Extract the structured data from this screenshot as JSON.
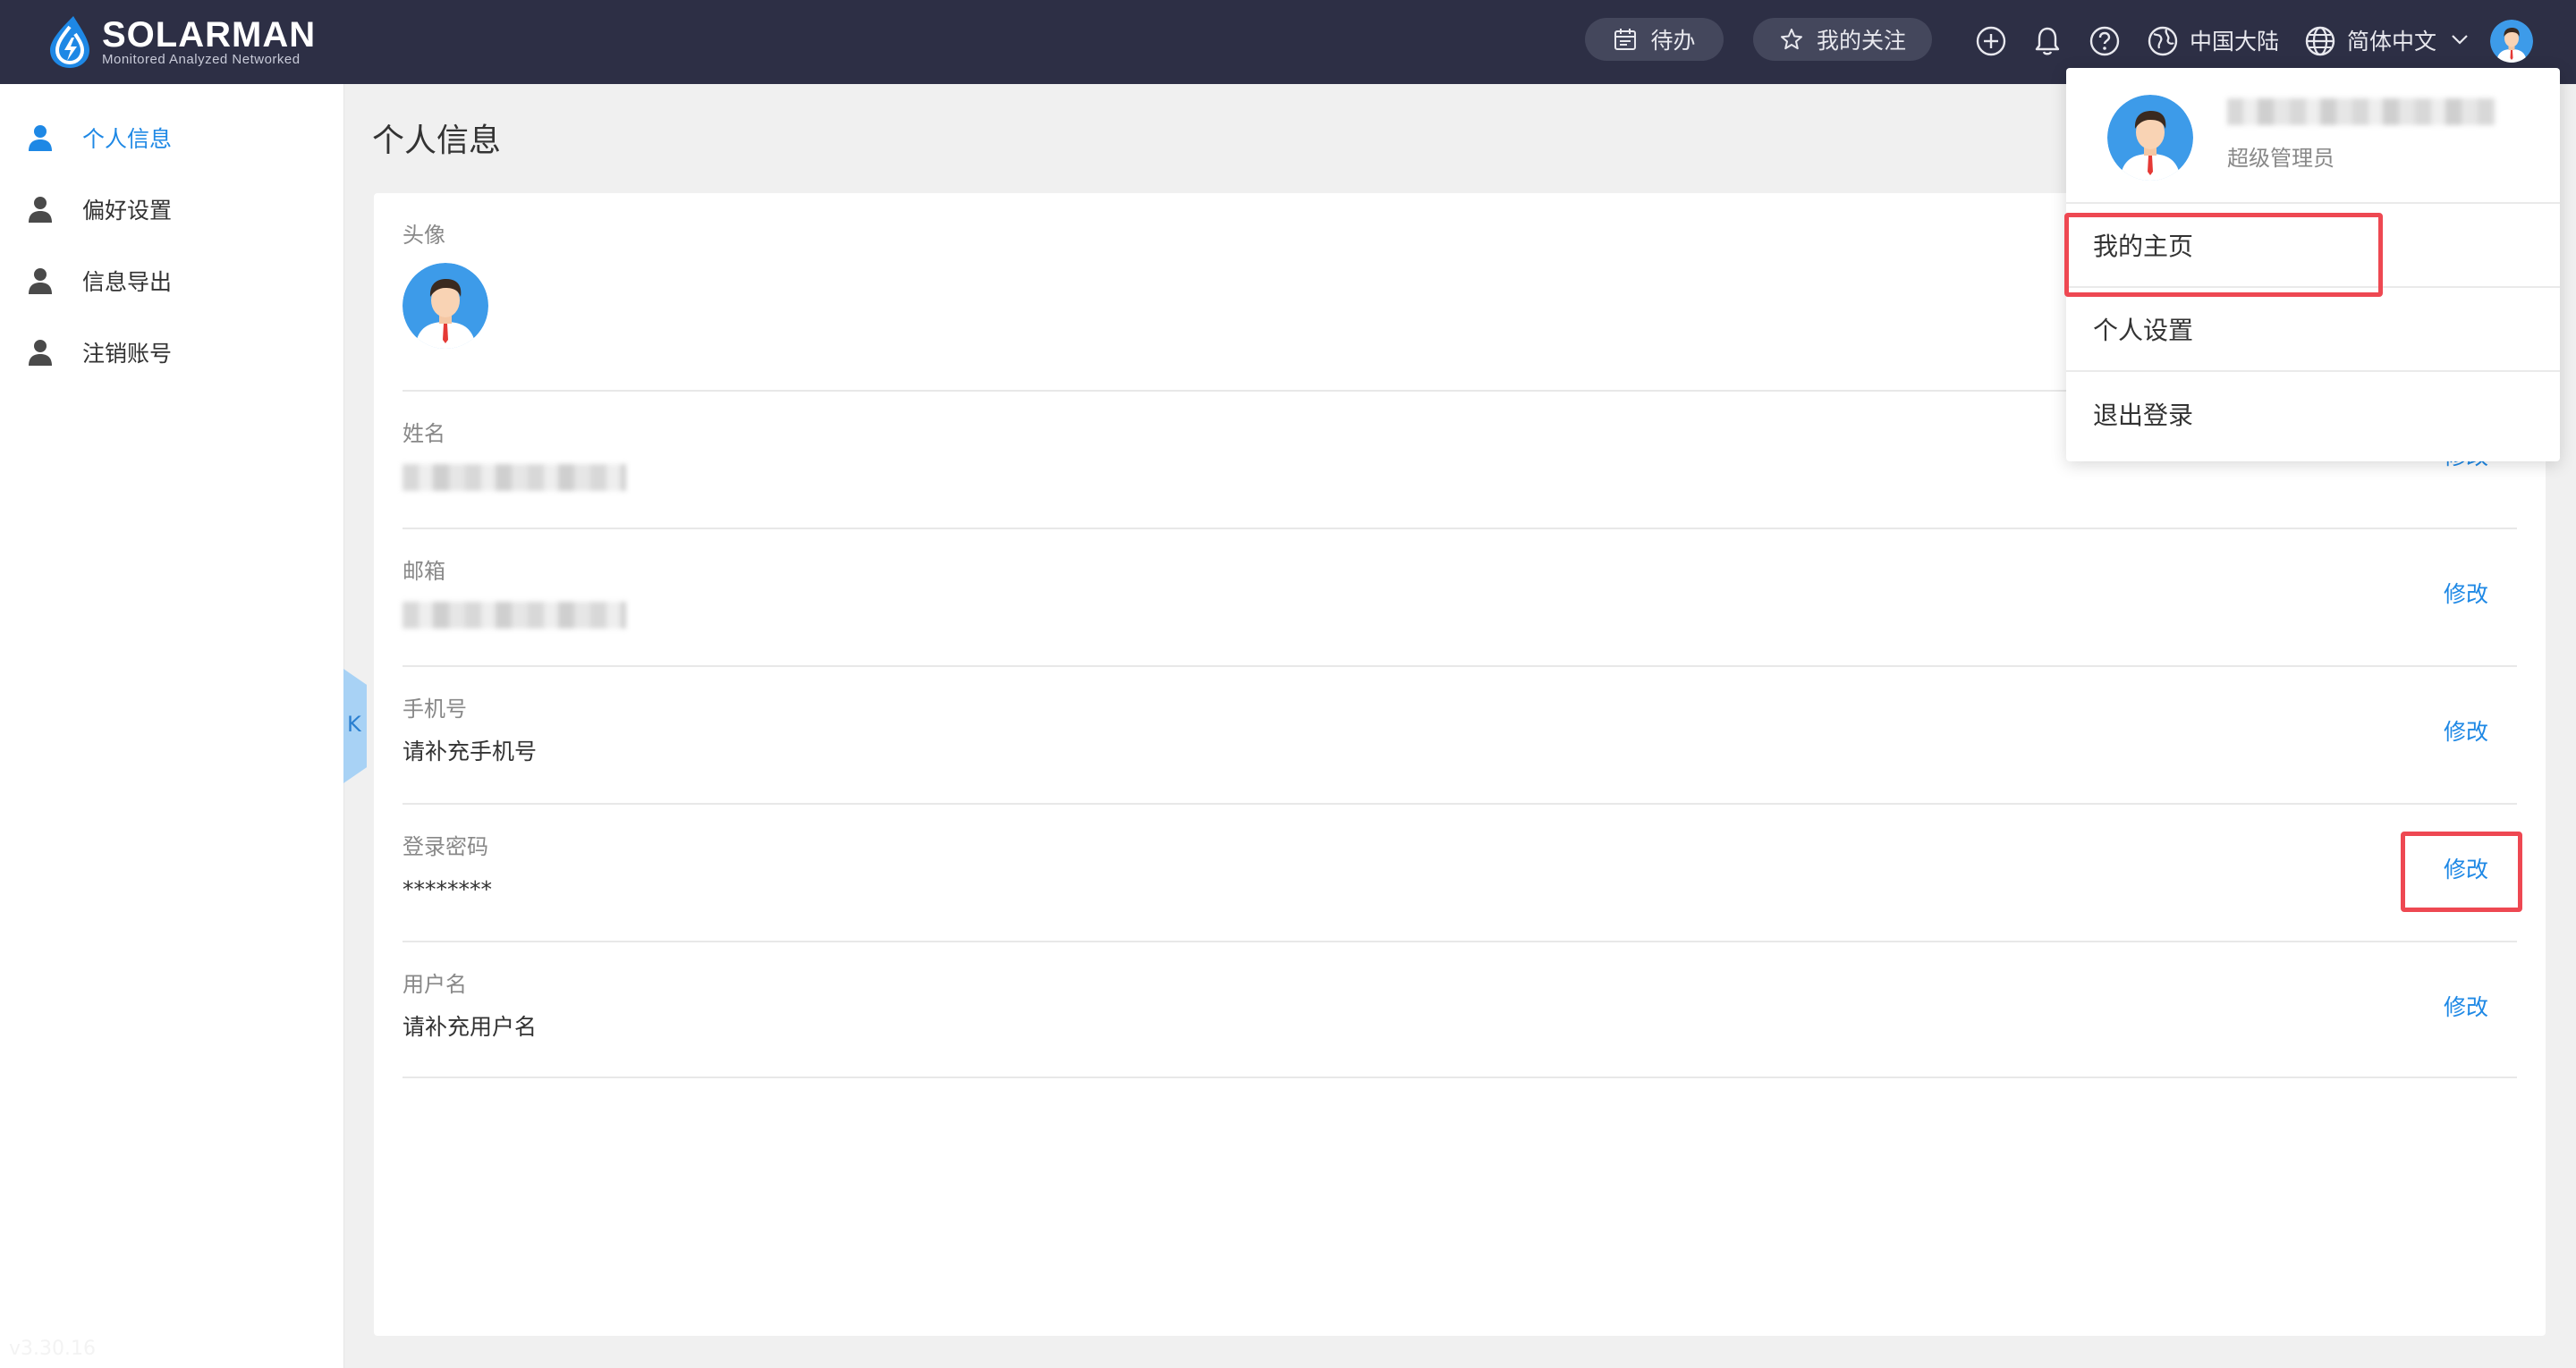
{
  "brand": {
    "name": "SOLARMAN",
    "tagline": "Monitored Analyzed Networked"
  },
  "topbar": {
    "todo_label": "待办",
    "favorites_label": "我的关注",
    "region_label": "中国大陆",
    "language_label": "简体中文",
    "icons": [
      "plus-circle-icon",
      "bell-icon",
      "help-icon",
      "globe-icon",
      "language-icon",
      "chevron-down-icon"
    ]
  },
  "sidebar": {
    "items": [
      {
        "label": "个人信息",
        "active": true
      },
      {
        "label": "偏好设置",
        "active": false
      },
      {
        "label": "信息导出",
        "active": false
      },
      {
        "label": "注销账号",
        "active": false
      }
    ],
    "version": "v3.30.16",
    "collapse_glyph": "K"
  },
  "page": {
    "title": "个人信息"
  },
  "profile": {
    "avatar_label": "头像",
    "edit_label": "修改",
    "fields": [
      {
        "label": "姓名",
        "value": ""
      },
      {
        "label": "邮箱",
        "value": ""
      },
      {
        "label": "手机号",
        "value": "请补充手机号"
      },
      {
        "label": "登录密码",
        "value": "********"
      },
      {
        "label": "用户名",
        "value": "请补充用户名"
      }
    ]
  },
  "user_menu": {
    "role": "超级管理员",
    "items": [
      "我的主页",
      "个人设置",
      "退出登录"
    ]
  },
  "colors": {
    "topbar_bg": "#2d2f45",
    "accent": "#1e88e5",
    "highlight": "#ee4852",
    "page_bg": "#f0f0f0"
  }
}
